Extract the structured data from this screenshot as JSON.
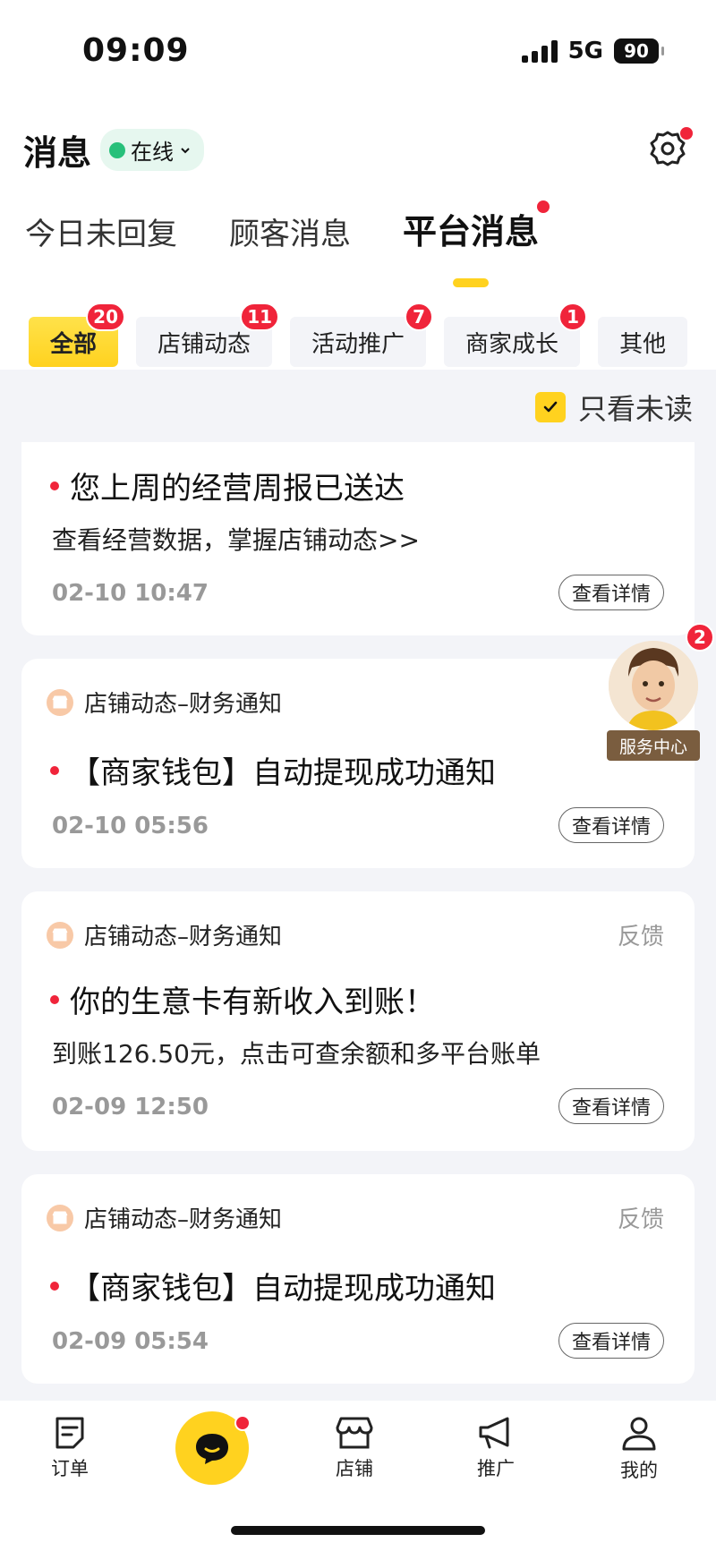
{
  "status": {
    "time": "09:09",
    "network": "5G",
    "battery": "90"
  },
  "header": {
    "title": "消息",
    "online_status": "在线"
  },
  "tabs": [
    {
      "label": "今日未回复"
    },
    {
      "label": "顾客消息"
    },
    {
      "label": "平台消息"
    }
  ],
  "chips": [
    {
      "label": "全部",
      "badge": "20"
    },
    {
      "label": "店铺动态",
      "badge": "11"
    },
    {
      "label": "活动推广",
      "badge": "7"
    },
    {
      "label": "商家成长",
      "badge": "1"
    },
    {
      "label": "其他"
    }
  ],
  "filter": {
    "label": "只看未读",
    "checked": true
  },
  "messages": [
    {
      "title": "您上周的经营周报已送达",
      "subtitle": "查看经营数据，掌握店铺动态>>",
      "time": "02-10 10:47",
      "button": "查看详情"
    },
    {
      "source": "店铺动态–财务通知",
      "title": "【商家钱包】自动提现成功通知",
      "time": "02-10 05:56",
      "button": "查看详情"
    },
    {
      "source": "店铺动态–财务通知",
      "feedback": "反馈",
      "title": "你的生意卡有新收入到账！",
      "subtitle": "到账126.50元，点击可查余额和多平台账单",
      "time": "02-09 12:50",
      "button": "查看详情"
    },
    {
      "source": "店铺动态–财务通知",
      "feedback": "反馈",
      "title": "【商家钱包】自动提现成功通知",
      "time": "02-09 05:54",
      "button": "查看详情"
    }
  ],
  "service_center": {
    "label": "服务中心",
    "badge": "2"
  },
  "bottom_nav": [
    {
      "label": "订单",
      "icon": "order-icon"
    },
    {
      "label": "",
      "icon": "message-bubble-icon"
    },
    {
      "label": "店铺",
      "icon": "store-icon"
    },
    {
      "label": "推广",
      "icon": "megaphone-icon"
    },
    {
      "label": "我的",
      "icon": "profile-icon"
    }
  ],
  "colors": {
    "accent": "#ffd21f",
    "badge": "#f0243a",
    "online": "#27c07a"
  }
}
